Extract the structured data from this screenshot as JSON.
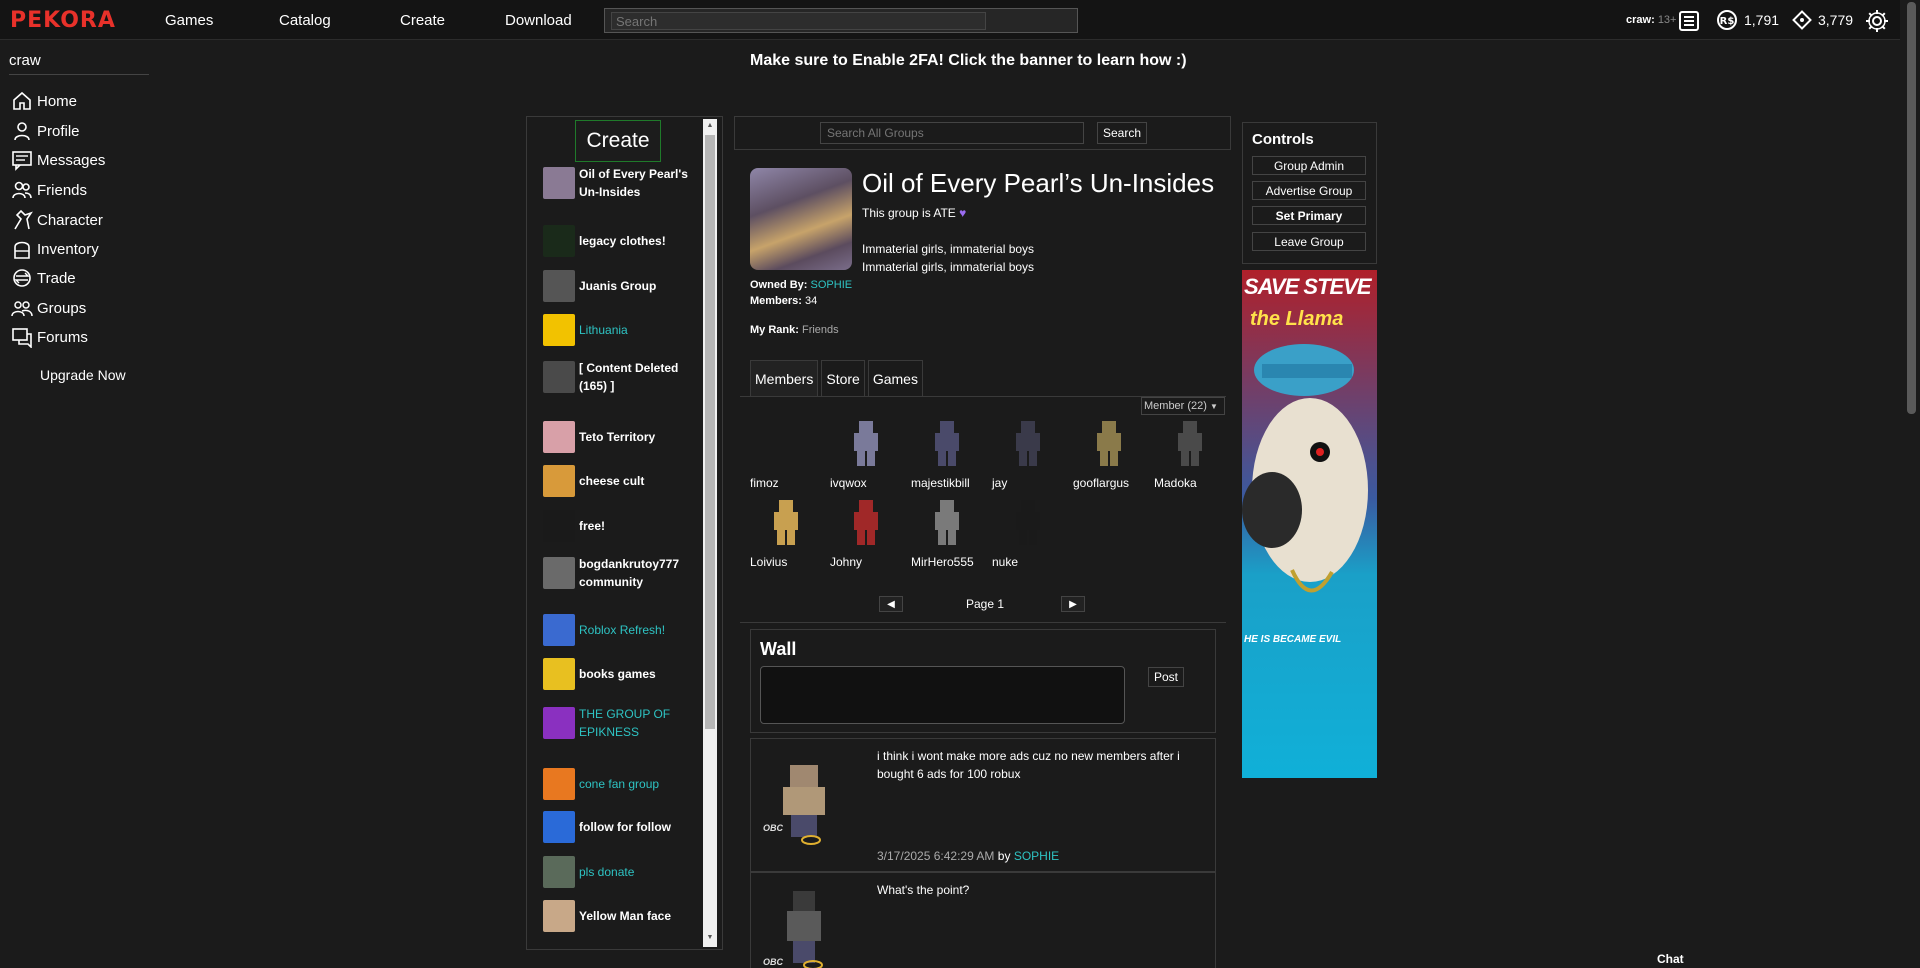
{
  "topbar": {
    "logo": "PEKORA",
    "nav": [
      "Games",
      "Catalog",
      "Create",
      "Download"
    ],
    "search_placeholder": "Search",
    "username": "craw:",
    "age_badge": "13+",
    "robux": "1,791",
    "tickets": "3,779"
  },
  "sidebar": {
    "username": "craw",
    "items": [
      {
        "label": "Home",
        "icon": "home-icon"
      },
      {
        "label": "Profile",
        "icon": "profile-icon"
      },
      {
        "label": "Messages",
        "icon": "messages-icon"
      },
      {
        "label": "Friends",
        "icon": "friends-icon"
      },
      {
        "label": "Character",
        "icon": "character-icon"
      },
      {
        "label": "Inventory",
        "icon": "inventory-icon"
      },
      {
        "label": "Trade",
        "icon": "trade-icon"
      },
      {
        "label": "Groups",
        "icon": "groups-icon"
      },
      {
        "label": "Forums",
        "icon": "forums-icon"
      }
    ],
    "upgrade": "Upgrade Now"
  },
  "banner": "Make sure to Enable 2FA! Click the banner to learn how :)",
  "group_list": {
    "create_label": "Create",
    "groups": [
      {
        "name_lines": [
          "Oil of Every Pearl's",
          "Un-Insides"
        ],
        "style": "bold",
        "color": "#8a7a94"
      },
      {
        "name_lines": [
          "legacy clothes!"
        ],
        "style": "bold",
        "color": "#1a2a1a"
      },
      {
        "name_lines": [
          "Juanis Group"
        ],
        "style": "bold",
        "color": "#555555"
      },
      {
        "name_lines": [
          "Lithuania"
        ],
        "style": "teal",
        "color": "#f2c200"
      },
      {
        "name_lines": [
          "[ Content Deleted",
          "(165) ]"
        ],
        "style": "bold",
        "color": "#4a4a4a"
      },
      {
        "name_lines": [
          "Teto Territory"
        ],
        "style": "bold",
        "color": "#d8a0a8"
      },
      {
        "name_lines": [
          "cheese cult"
        ],
        "style": "bold",
        "color": "#d89a3a"
      },
      {
        "name_lines": [
          "free!"
        ],
        "style": "bold",
        "color": "#1a1a1a"
      },
      {
        "name_lines": [
          "bogdankrutoy777",
          "community"
        ],
        "style": "bold",
        "color": "#6a6a6a"
      },
      {
        "name_lines": [
          "Roblox Refresh!"
        ],
        "style": "teal",
        "color": "#3a6ad0"
      },
      {
        "name_lines": [
          "books games"
        ],
        "style": "bold",
        "color": "#e8c020"
      },
      {
        "name_lines": [
          "THE GROUP OF",
          "EPIKNESS"
        ],
        "style": "teal",
        "color": "#8a30c0"
      },
      {
        "name_lines": [
          "cone fan group"
        ],
        "style": "teal",
        "color": "#e87820"
      },
      {
        "name_lines": [
          "follow for follow"
        ],
        "style": "bold",
        "color": "#2a6ad8"
      },
      {
        "name_lines": [
          "pls donate"
        ],
        "style": "teal",
        "color": "#5a6a5a"
      },
      {
        "name_lines": [
          "Yellow Man face"
        ],
        "style": "bold",
        "color": "#c8a888"
      }
    ]
  },
  "search_groups": {
    "placeholder": "Search All Groups",
    "button": "Search"
  },
  "group": {
    "title": "Oil of Every Pearl’s Un-Insides",
    "status": "This group is ATE",
    "desc_line1": "Immaterial girls, immaterial boys",
    "desc_line2": "Immaterial girls, immaterial boys",
    "owned_by_label": "Owned By:",
    "owner": "SOPHIE",
    "members_label": "Members:",
    "members_count": "34",
    "rank_label": "My Rank:",
    "rank": "Friends"
  },
  "tabs": [
    "Members",
    "Store",
    "Games"
  ],
  "role_select": "Member (22)",
  "members": [
    {
      "name": "fimoz",
      "color": "#1b1b1b"
    },
    {
      "name": "ivqwox",
      "color": "#7a7a9a"
    },
    {
      "name": "majestikbill",
      "color": "#4a4a6a"
    },
    {
      "name": "jay",
      "color": "#3a3a4a"
    },
    {
      "name": "gooflargus",
      "color": "#8a7a4a"
    },
    {
      "name": "Madoka",
      "color": "#4a4a4a"
    },
    {
      "name": "Loivius",
      "color": "#c8a050"
    },
    {
      "name": "Johny",
      "color": "#a02828"
    },
    {
      "name": "MirHero555",
      "color": "#7a7a7a"
    },
    {
      "name": "nuke",
      "color": "#1a1a1a"
    }
  ],
  "pager": {
    "label": "Page 1",
    "prev": "◀",
    "next": "▶"
  },
  "wall": {
    "title": "Wall",
    "post_label": "Post"
  },
  "posts": [
    {
      "text": "i think i wont make more ads cuz no new members after i bought 6 ads for 100 robux",
      "date": "3/17/2025 6:42:29 AM",
      "by": "by",
      "author": "SOPHIE",
      "badge": "OBC"
    },
    {
      "text": "What's the point?",
      "badge": "OBC"
    }
  ],
  "controls": {
    "title": "Controls",
    "buttons": [
      "Group Admin",
      "Advertise Group",
      "Set Primary",
      "Leave Group"
    ]
  },
  "ad": {
    "line1": "SAVE STEVE",
    "line2": "the Llama",
    "bottom": "HE IS BECAME EVIL"
  },
  "chat": "Chat"
}
